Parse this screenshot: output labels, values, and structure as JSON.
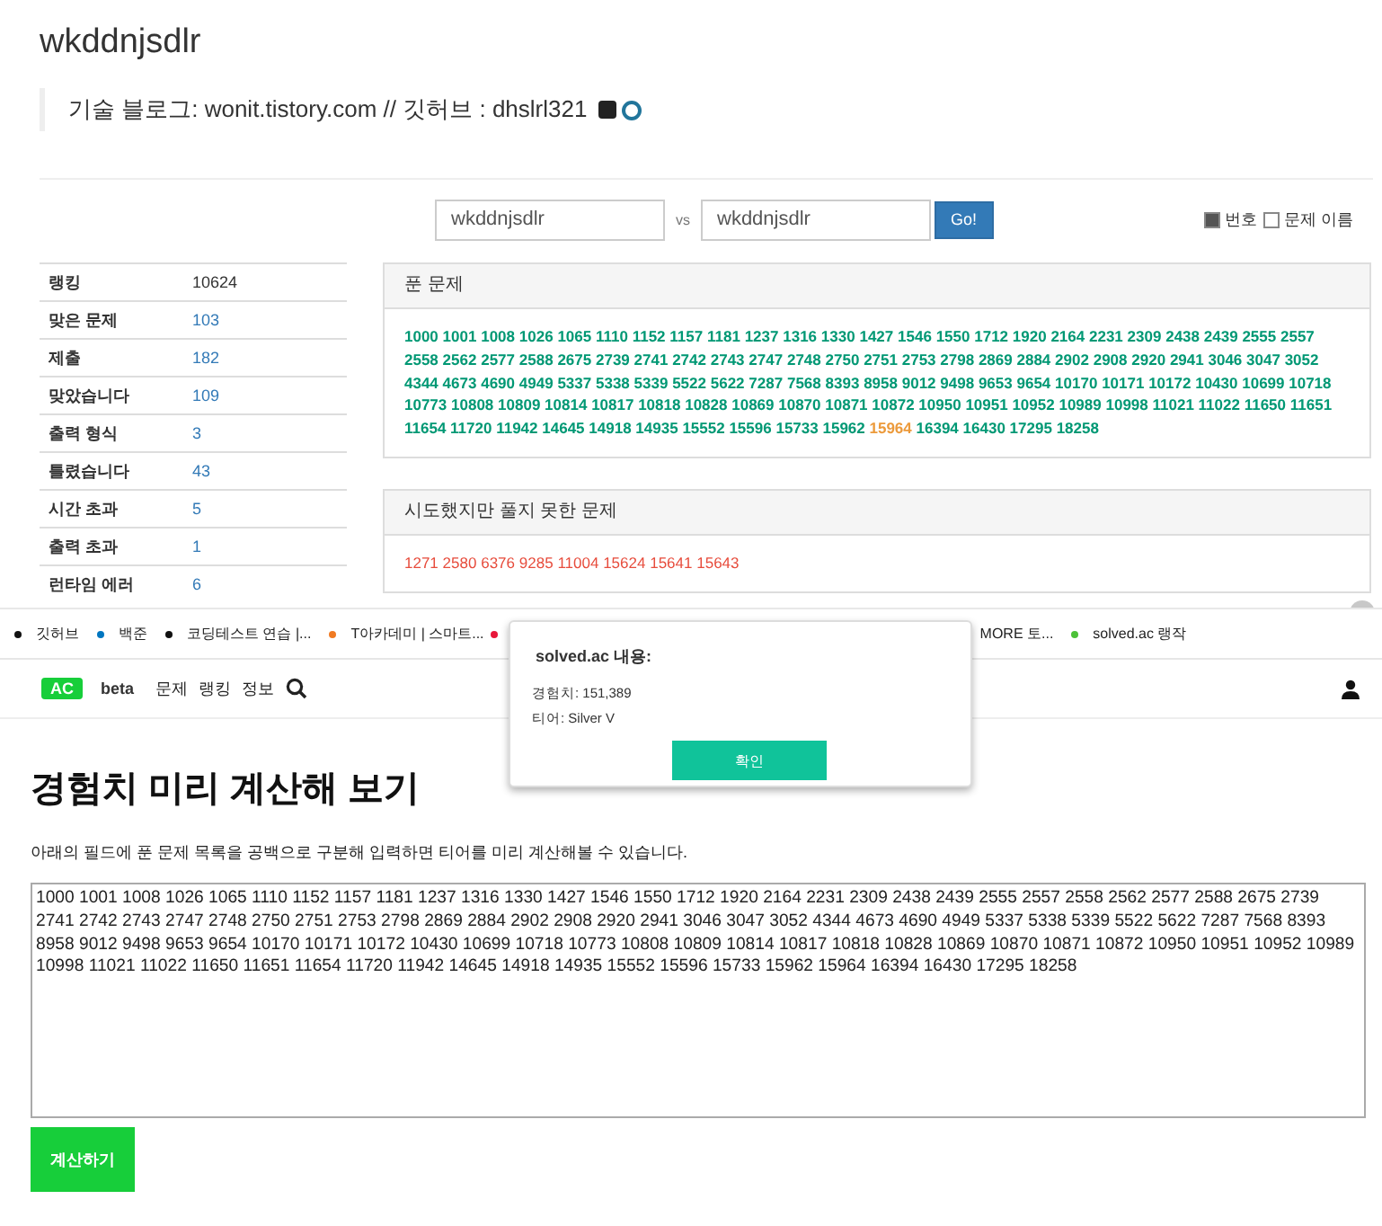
{
  "profile": {
    "username": "wkddnjsdlr",
    "bio": "기술 블로그: wonit.tistory.com // 깃허브 : dhslrl321"
  },
  "compare": {
    "user_a": "wkddnjsdlr",
    "vs": "vs",
    "user_b": "wkddnjsdlr",
    "button": "Go!",
    "options": [
      {
        "label": "번호",
        "checked": true
      },
      {
        "label": "문제 이름",
        "checked": false
      }
    ]
  },
  "stats": [
    {
      "label": "랭킹",
      "value": "10624",
      "kind": "text"
    },
    {
      "label": "맞은 문제",
      "value": "103",
      "kind": "link"
    },
    {
      "label": "제출",
      "value": "182",
      "kind": "link"
    },
    {
      "label": "맞았습니다",
      "value": "109",
      "kind": "link"
    },
    {
      "label": "출력 형식",
      "value": "3",
      "kind": "link"
    },
    {
      "label": "틀렸습니다",
      "value": "43",
      "kind": "link"
    },
    {
      "label": "시간 초과",
      "value": "5",
      "kind": "link"
    },
    {
      "label": "출력 초과",
      "value": "1",
      "kind": "link"
    },
    {
      "label": "런타임 에러",
      "value": "6",
      "kind": "link"
    }
  ],
  "solved": {
    "title": "푼 문제",
    "problems": [
      {
        "id": "1000",
        "kind": "solved"
      },
      {
        "id": "1001",
        "kind": "solved"
      },
      {
        "id": "1008",
        "kind": "solved"
      },
      {
        "id": "1026",
        "kind": "solved"
      },
      {
        "id": "1065",
        "kind": "solved"
      },
      {
        "id": "1110",
        "kind": "solved"
      },
      {
        "id": "1152",
        "kind": "solved"
      },
      {
        "id": "1157",
        "kind": "solved"
      },
      {
        "id": "1181",
        "kind": "solved"
      },
      {
        "id": "1237",
        "kind": "solved"
      },
      {
        "id": "1316",
        "kind": "solved"
      },
      {
        "id": "1330",
        "kind": "solved"
      },
      {
        "id": "1427",
        "kind": "solved"
      },
      {
        "id": "1546",
        "kind": "solved"
      },
      {
        "id": "1550",
        "kind": "solved"
      },
      {
        "id": "1712",
        "kind": "solved"
      },
      {
        "id": "1920",
        "kind": "solved"
      },
      {
        "id": "2164",
        "kind": "solved"
      },
      {
        "id": "2231",
        "kind": "solved"
      },
      {
        "id": "2309",
        "kind": "solved"
      },
      {
        "id": "2438",
        "kind": "solved"
      },
      {
        "id": "2439",
        "kind": "solved"
      },
      {
        "id": "2555",
        "kind": "solved"
      },
      {
        "id": "2557",
        "kind": "solved"
      },
      {
        "id": "2558",
        "kind": "solved"
      },
      {
        "id": "2562",
        "kind": "solved"
      },
      {
        "id": "2577",
        "kind": "solved"
      },
      {
        "id": "2588",
        "kind": "solved"
      },
      {
        "id": "2675",
        "kind": "solved"
      },
      {
        "id": "2739",
        "kind": "solved"
      },
      {
        "id": "2741",
        "kind": "solved"
      },
      {
        "id": "2742",
        "kind": "solved"
      },
      {
        "id": "2743",
        "kind": "solved"
      },
      {
        "id": "2747",
        "kind": "solved"
      },
      {
        "id": "2748",
        "kind": "solved"
      },
      {
        "id": "2750",
        "kind": "solved"
      },
      {
        "id": "2751",
        "kind": "solved"
      },
      {
        "id": "2753",
        "kind": "solved"
      },
      {
        "id": "2798",
        "kind": "solved"
      },
      {
        "id": "2869",
        "kind": "solved"
      },
      {
        "id": "2884",
        "kind": "solved"
      },
      {
        "id": "2902",
        "kind": "solved"
      },
      {
        "id": "2908",
        "kind": "solved"
      },
      {
        "id": "2920",
        "kind": "solved"
      },
      {
        "id": "2941",
        "kind": "solved"
      },
      {
        "id": "3046",
        "kind": "solved"
      },
      {
        "id": "3047",
        "kind": "solved"
      },
      {
        "id": "3052",
        "kind": "solved"
      },
      {
        "id": "4344",
        "kind": "solved"
      },
      {
        "id": "4673",
        "kind": "solved"
      },
      {
        "id": "4690",
        "kind": "solved"
      },
      {
        "id": "4949",
        "kind": "solved"
      },
      {
        "id": "5337",
        "kind": "solved"
      },
      {
        "id": "5338",
        "kind": "solved"
      },
      {
        "id": "5339",
        "kind": "solved"
      },
      {
        "id": "5522",
        "kind": "solved"
      },
      {
        "id": "5622",
        "kind": "solved"
      },
      {
        "id": "7287",
        "kind": "solved"
      },
      {
        "id": "7568",
        "kind": "solved"
      },
      {
        "id": "8393",
        "kind": "solved"
      },
      {
        "id": "8958",
        "kind": "solved"
      },
      {
        "id": "9012",
        "kind": "solved"
      },
      {
        "id": "9498",
        "kind": "solved"
      },
      {
        "id": "9653",
        "kind": "solved"
      },
      {
        "id": "9654",
        "kind": "solved"
      },
      {
        "id": "10170",
        "kind": "solved"
      },
      {
        "id": "10171",
        "kind": "solved"
      },
      {
        "id": "10172",
        "kind": "solved"
      },
      {
        "id": "10430",
        "kind": "solved"
      },
      {
        "id": "10699",
        "kind": "solved"
      },
      {
        "id": "10718",
        "kind": "solved"
      },
      {
        "id": "10773",
        "kind": "solved"
      },
      {
        "id": "10808",
        "kind": "solved"
      },
      {
        "id": "10809",
        "kind": "solved"
      },
      {
        "id": "10814",
        "kind": "solved"
      },
      {
        "id": "10817",
        "kind": "solved"
      },
      {
        "id": "10818",
        "kind": "solved"
      },
      {
        "id": "10828",
        "kind": "solved"
      },
      {
        "id": "10869",
        "kind": "solved"
      },
      {
        "id": "10870",
        "kind": "solved"
      },
      {
        "id": "10871",
        "kind": "solved"
      },
      {
        "id": "10872",
        "kind": "solved"
      },
      {
        "id": "10950",
        "kind": "solved"
      },
      {
        "id": "10951",
        "kind": "solved"
      },
      {
        "id": "10952",
        "kind": "solved"
      },
      {
        "id": "10989",
        "kind": "solved"
      },
      {
        "id": "10998",
        "kind": "solved"
      },
      {
        "id": "11021",
        "kind": "solved"
      },
      {
        "id": "11022",
        "kind": "solved"
      },
      {
        "id": "11650",
        "kind": "solved"
      },
      {
        "id": "11651",
        "kind": "solved"
      },
      {
        "id": "11654",
        "kind": "solved"
      },
      {
        "id": "11720",
        "kind": "solved"
      },
      {
        "id": "11942",
        "kind": "solved"
      },
      {
        "id": "14645",
        "kind": "solved"
      },
      {
        "id": "14918",
        "kind": "solved"
      },
      {
        "id": "14935",
        "kind": "solved"
      },
      {
        "id": "15552",
        "kind": "solved"
      },
      {
        "id": "15596",
        "kind": "solved"
      },
      {
        "id": "15733",
        "kind": "solved"
      },
      {
        "id": "15962",
        "kind": "solved"
      },
      {
        "id": "15964",
        "kind": "partial"
      },
      {
        "id": "16394",
        "kind": "solved"
      },
      {
        "id": "16430",
        "kind": "solved"
      },
      {
        "id": "17295",
        "kind": "solved"
      },
      {
        "id": "18258",
        "kind": "solved"
      }
    ]
  },
  "failed": {
    "title": "시도했지만 풀지 못한 문제",
    "problems": [
      "1271",
      "2580",
      "6376",
      "9285",
      "11004",
      "15624",
      "15641",
      "15643"
    ]
  },
  "bookmarks": [
    {
      "label": "깃허브",
      "color": "#111111"
    },
    {
      "label": "백준",
      "color": "#0076c0"
    },
    {
      "label": "코딩테스트 연습 |...",
      "color": "#111111"
    },
    {
      "label": "T아카데미 | 스마트...",
      "color": "#f07a22"
    },
    {
      "color": "#e8173a"
    },
    {
      "label": "MORE 토..."
    },
    {
      "label": "solved.ac 랭작",
      "color": "#4cc138"
    }
  ],
  "nav": {
    "logo": "AC",
    "beta": "beta",
    "items": [
      "문제",
      "랭킹",
      "정보"
    ]
  },
  "calculator": {
    "title": "경험치 미리 계산해 보기",
    "description": "아래의 필드에 푼 문제 목록을 공백으로 구분해 입력하면 티어를 미리 계산해볼 수 있습니다.",
    "value": "1000 1001 1008 1026 1065 1110 1152 1157 1181 1237 1316 1330 1427 1546 1550 1712 1920 2164 2231 2309 2438 2439 2555 2557 2558 2562 2577 2588 2675 2739 2741 2742 2743 2747 2748 2750 2751 2753 2798 2869 2884 2902 2908 2920 2941 3046 3047 3052 4344 4673 4690 4949 5337 5338 5339 5522 5622 7287 7568 8393 8958 9012 9498 9653 9654 10170 10171 10172 10430 10699 10718 10773 10808 10809 10814 10817 10818 10828 10869 10870 10871 10872 10950 10951 10952 10989 10998 11021 11022 11650 11651 11654 11720 11942 14645 14918 14935 15552 15596 15733 15962 15964 16394 16430 17295 18258",
    "button": "계산하기"
  },
  "dialog": {
    "title": "solved.ac 내용:",
    "lines": [
      "경험치: 151,389",
      "티어: Silver V"
    ],
    "button": "확인"
  }
}
